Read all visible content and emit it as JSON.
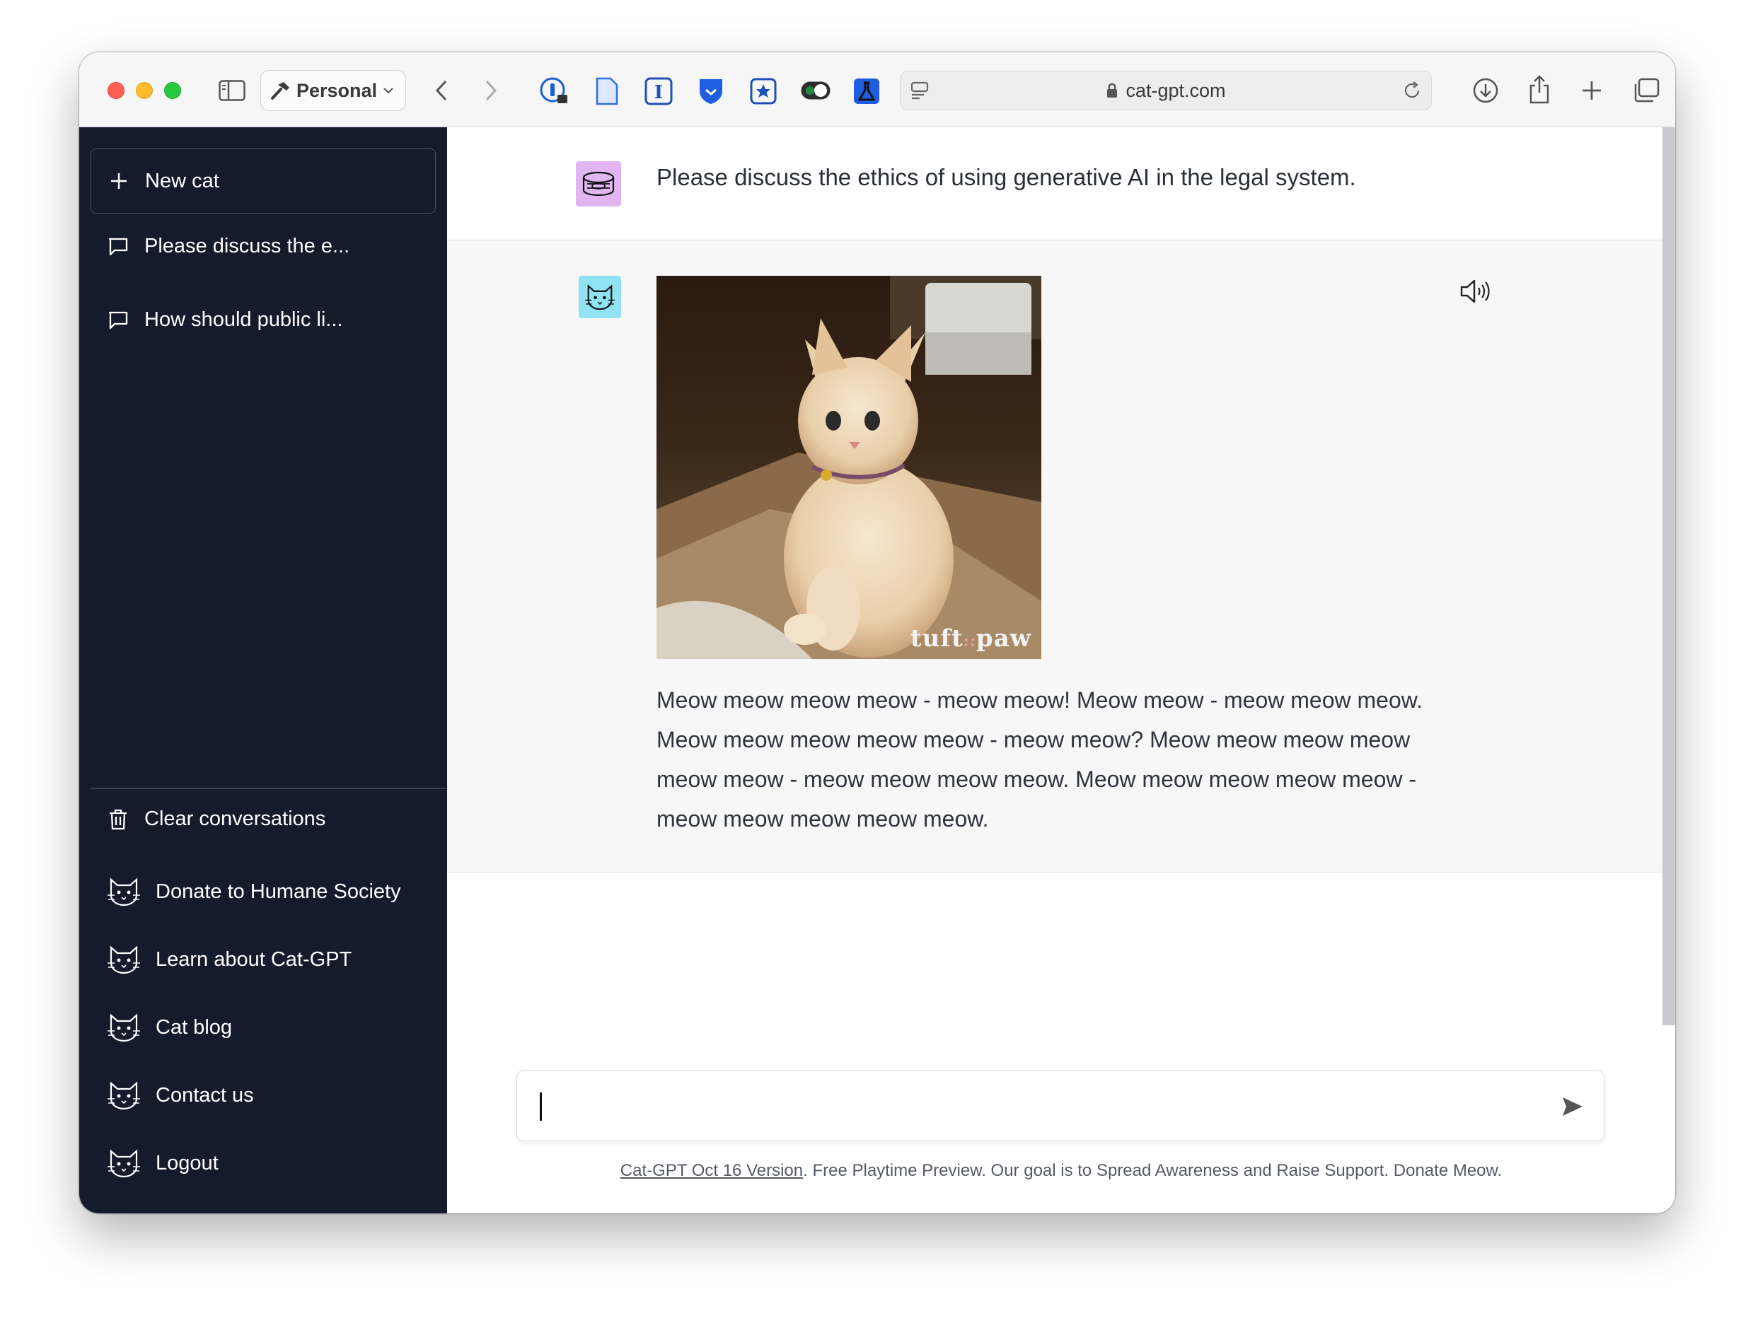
{
  "browser": {
    "profile_label": "Personal",
    "url": "cat-gpt.com"
  },
  "sidebar": {
    "new_label": "New cat",
    "conversations": [
      {
        "label": "Please discuss the e..."
      },
      {
        "label": "How should public li..."
      }
    ],
    "clear_label": "Clear conversations",
    "links": [
      {
        "label": "Donate to Humane Society"
      },
      {
        "label": "Learn about Cat-GPT"
      },
      {
        "label": "Cat blog"
      },
      {
        "label": "Contact us"
      },
      {
        "label": "Logout"
      }
    ]
  },
  "chat": {
    "user_message": "Please discuss the ethics of using generative AI in the legal system.",
    "image_watermark": "tuft paw",
    "bot_message": "Meow meow meow meow - meow meow! Meow meow - meow meow meow. Meow meow meow meow meow - meow meow? Meow meow meow meow meow meow - meow meow meow meow. Meow meow meow meow meow - meow meow meow meow meow."
  },
  "input": {
    "value": ""
  },
  "footer": {
    "version_link": "Cat-GPT Oct 16 Version",
    "text": ". Free Playtime Preview. Our goal is to Spread Awareness and Raise Support. Donate Meow."
  },
  "icons": {
    "extensions": [
      "onepassword-icon",
      "document-icon",
      "instapaper-icon",
      "bitwarden-icon",
      "star-badge-icon",
      "toggle-icon",
      "flask-icon"
    ],
    "brand_colors": {
      "sidebar": "#141b2b",
      "user_avatar": "#e1b6f0",
      "bot_avatar": "#8fe3f2"
    }
  }
}
